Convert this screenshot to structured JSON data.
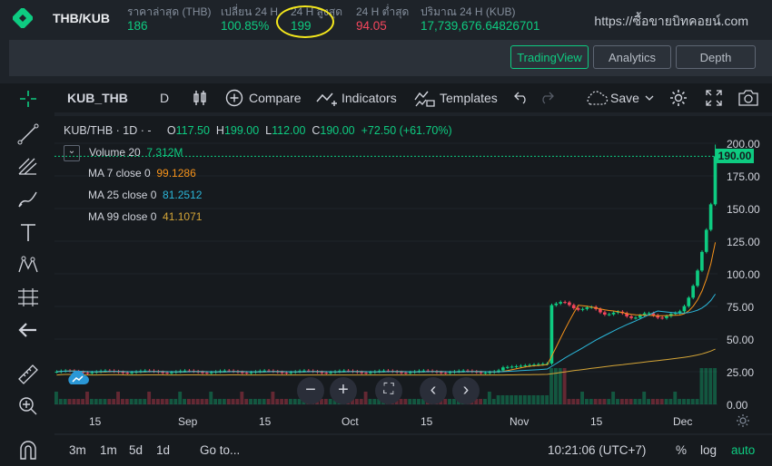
{
  "header": {
    "pair": "THB/KUB",
    "stats": [
      {
        "label": "ราคาล่าสุด (THB)",
        "value": "186",
        "color": "#0ecb81"
      },
      {
        "label": "เปลี่ยน 24 H",
        "value": "100.85%",
        "color": "#0ecb81"
      },
      {
        "label": "24 H สูงสุด",
        "value": "199",
        "color": "#0ecb81"
      },
      {
        "label": "24 H ต่ำสุด",
        "value": "94.05",
        "color": "#f6465d"
      },
      {
        "label": "ปริมาณ 24 H (KUB)",
        "value": "17,739,676.64826701",
        "color": "#0ecb81"
      }
    ],
    "watermark": "https://ซื้อขายบิทคอยน์.com"
  },
  "view_tabs": [
    {
      "label": "TradingView",
      "active": true
    },
    {
      "label": "Analytics",
      "active": false
    },
    {
      "label": "Depth",
      "active": false
    }
  ],
  "toolbar": {
    "symbol": "KUB_THB",
    "interval": "D",
    "compare": "Compare",
    "indicators": "Indicators",
    "templates": "Templates",
    "save": "Save"
  },
  "legend": {
    "title": "KUB/THB · 1D · -",
    "o_label": "O",
    "o": "117.50",
    "h_label": "H",
    "h": "199.00",
    "l_label": "L",
    "l": "112.00",
    "c_label": "C",
    "c": "190.00",
    "change": "+72.50 (+61.70%)",
    "volume_label": "Volume 20",
    "volume_value": "7.312M",
    "ma7_label": "MA 7 close 0",
    "ma7_value": "99.1286",
    "ma7_color": "#f7931a",
    "ma25_label": "MA 25 close 0",
    "ma25_value": "81.2512",
    "ma25_color": "#2bb7da",
    "ma99_label": "MA 99 close 0",
    "ma99_value": "41.1071",
    "ma99_color": "#d4a537"
  },
  "price_axis": {
    "ticks": [
      "200.00",
      "175.00",
      "150.00",
      "125.00",
      "100.00",
      "75.00",
      "50.00",
      "25.00",
      "0.00"
    ],
    "current": "190.00"
  },
  "time_axis": [
    "15",
    "Sep",
    "15",
    "Oct",
    "15",
    "Nov",
    "15",
    "Dec"
  ],
  "bottom": {
    "ranges": [
      "3m",
      "1m",
      "5d",
      "1d"
    ],
    "goto": "Go to...",
    "time": "10:21:06 (UTC+7)",
    "percent": "%",
    "log": "log",
    "auto": "auto"
  },
  "chart_data": {
    "type": "candlestick",
    "last_close": 190.0,
    "ylim": [
      0,
      200
    ]
  }
}
